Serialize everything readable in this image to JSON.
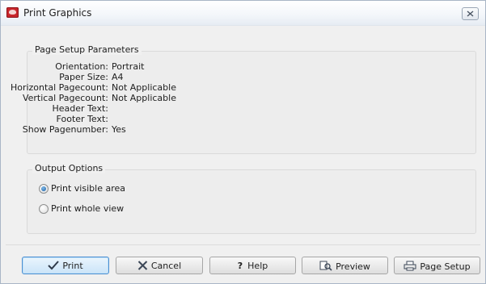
{
  "window": {
    "title": "Print Graphics",
    "close_icon": "close-icon"
  },
  "page_setup": {
    "legend": "Page Setup Parameters",
    "rows": [
      {
        "label": "Orientation:",
        "value": "Portrait"
      },
      {
        "label": "Paper Size:",
        "value": "A4"
      },
      {
        "label": "Horizontal Pagecount:",
        "value": "Not Applicable"
      },
      {
        "label": "Vertical Pagecount:",
        "value": "Not Applicable"
      },
      {
        "label": "Header Text:",
        "value": ""
      },
      {
        "label": "Footer Text:",
        "value": ""
      },
      {
        "label": "Show Pagenumber:",
        "value": "Yes"
      }
    ]
  },
  "output_options": {
    "legend": "Output Options",
    "options": [
      {
        "label": "Print visible area",
        "selected": true
      },
      {
        "label": "Print whole view",
        "selected": false
      }
    ]
  },
  "buttons": {
    "print": {
      "label": "Print",
      "icon": "checkmark-icon"
    },
    "cancel": {
      "label": "Cancel",
      "icon": "x-icon"
    },
    "help": {
      "label": "Help",
      "icon": "question-mark-icon"
    },
    "preview": {
      "label": "Preview",
      "icon": "preview-icon"
    },
    "page_setup": {
      "label": "Page Setup",
      "icon": "page-setup-icon"
    }
  },
  "colors": {
    "accent": "#4b8fd1",
    "app_icon": "#c8262b"
  }
}
